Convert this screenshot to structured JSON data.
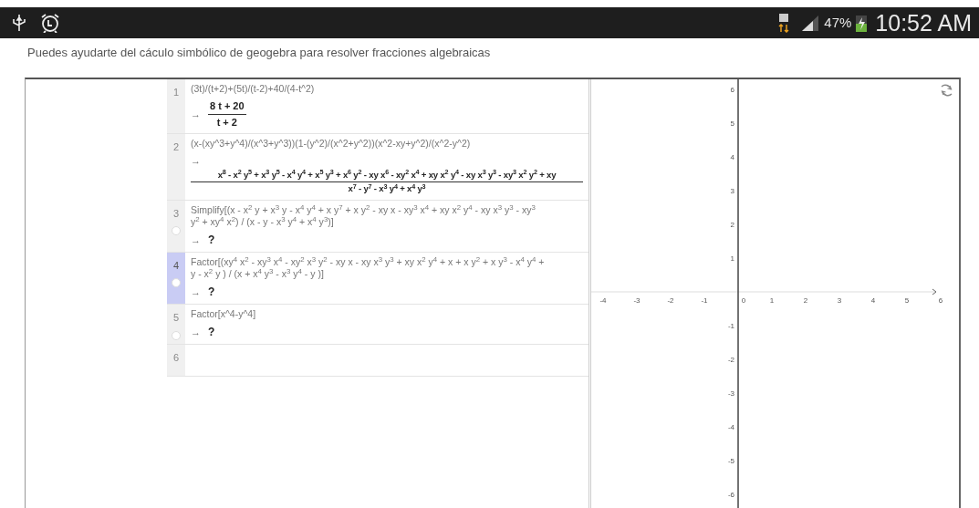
{
  "status_bar": {
    "time": "10:52 AM",
    "battery": "47%"
  },
  "caption": "Puedes ayudarte del cáculo simbólico de geogebra para resolver fracciones algebraicas",
  "algebra_rows": [
    {
      "number": "1",
      "selected": false,
      "kind": "fraction",
      "input": [
        "(3t)/(t+2)+(5t)/(t-2)+40/(4-t^2)"
      ],
      "arrow": "→",
      "numerator": "8 t + 20",
      "denominator": "t + 2"
    },
    {
      "number": "2",
      "selected": false,
      "kind": "fraction",
      "input": [
        "(x-(xy^3+y^4)/(x^3+y^3))(1-(y^2)/(x^2+y^2))(x^2-xy+y^2)/(x^2-y^2)"
      ],
      "arrow": "→",
      "numerator": "x$^{8}$ - x$^{2}$ y$^{5}$ + x$^{3}$ y$^{5}$ - x$^{4}$ y$^{4}$ + x$^{5}$ y$^{3}$ + x$^{6}$ y$^{2}$ - xy x$^{6}$ - xy$^{2}$ x$^{4}$ + xy x$^{2}$ y$^{4}$ - xy x$^{3}$ y$^{3}$ - xy$^{3}$ x$^{2}$ y$^{2}$ + xy",
      "denominator": "x$^{7}$ - y$^{7}$ - x$^{3}$ y$^{4}$ + x$^{4}$ y$^{3}$"
    },
    {
      "number": "3",
      "selected": false,
      "kind": "undefined",
      "visible": false,
      "input": [
        "Simplify[(x  - x$^{2}$ y  + x$^{3}$ y  - x$^{4}$ y$^{4}$ + x  y$^{7}$ + x  y$^{2}$ - xy x  - xy$^{3}$ x$^{4}$ + xy x$^{2}$ y$^{4}$ - xy x$^{3}$ y$^{3}$ - xy$^{3}$",
        "y$^{2}$ + xy$^{4}$ x$^{2}$) / (x  - y  - x$^{3}$ y$^{4}$ + x$^{4}$ y$^{3}$)]"
      ],
      "arrow": "→",
      "result": "?"
    },
    {
      "number": "4",
      "selected": true,
      "kind": "undefined",
      "visible": false,
      "input": [
        "Factor[(xy$^{4}$ x$^{2}$ - xy$^{3}$ x$^{4}$ - xy$^{2}$ x$^{3}$ y$^{2}$ - xy x  - xy x$^{3}$ y$^{3}$ + xy x$^{2}$ y$^{4}$ + x  + x  y$^{2}$ + x  y$^{3}$ - x$^{4}$ y$^{4}$ +",
        "y  - x$^{2}$ y ) / (x  + x$^{4}$ y$^{3}$ - x$^{3}$ y$^{4}$ - y )]"
      ],
      "arrow": "→",
      "result": "?"
    },
    {
      "number": "5",
      "selected": false,
      "kind": "undefined",
      "visible": false,
      "input": [
        "Factor[x^4-y^4]"
      ],
      "arrow": "→",
      "result": "?"
    },
    {
      "number": "6",
      "selected": false,
      "kind": "empty"
    }
  ],
  "graphics": {
    "x_labels": [
      "-4",
      "-3",
      "-2",
      "-1",
      "0",
      "1",
      "2",
      "3",
      "4",
      "5",
      "6"
    ],
    "y_labels": [
      "6",
      "5",
      "4",
      "3",
      "2",
      "1",
      "-1",
      "-2",
      "-3",
      "-4",
      "-5",
      "-6"
    ]
  }
}
